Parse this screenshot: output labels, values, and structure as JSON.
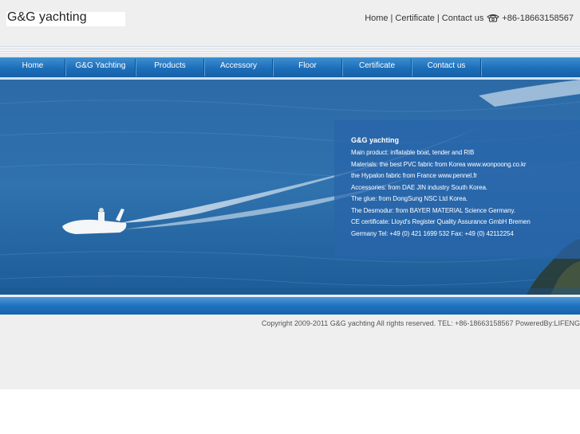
{
  "logo": {
    "text": "G&G yachting"
  },
  "toplinks": {
    "home": "Home",
    "separator": "|",
    "certificate": "Certificate",
    "contact": "Contact us",
    "phone": "+86-18663158567",
    "phone_icon": "telephone-icon"
  },
  "nav": {
    "items": [
      {
        "label": "Home"
      },
      {
        "label": "G&G Yachting"
      },
      {
        "label": "Products"
      },
      {
        "label": "Accessory"
      },
      {
        "label": "Floor"
      },
      {
        "label": "Certificate"
      },
      {
        "label": "Contact us"
      }
    ]
  },
  "info": {
    "title": "G&G yachting",
    "lines": [
      "Main product: inflatable boat, tender and RIB",
      "Materials: the best PVC fabric from Korea www.wonpoong.co.kr",
      "the Hypalon fabric from France www.pennel.fr",
      "Accessories: from DAE JIN industry South Korea.",
      "The glue:   from DongSung NSC Ltd Korea.",
      "The Desmodur:   from BAYER MATERIAL Science Germany.",
      "CE certificate: Lloyd's Register Quality Assurance GmbH Bremen",
      "Germany Tel: +49 (0) 421 1699 532 Fax: +49 (0) 42112254"
    ]
  },
  "footer": {
    "copyright": "Copyright 2009-2011 G&G yachting  All rights reserved.  TEL: +86-18663158567  PoweredBy:LIFENG"
  },
  "colors": {
    "nav_blue": "#1c6db8",
    "sea_blue": "#2f6fa8",
    "page_gray": "#efefef"
  }
}
